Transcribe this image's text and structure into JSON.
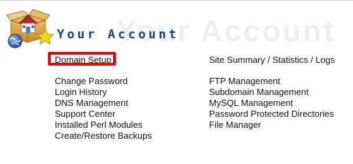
{
  "header": {
    "title": "Your Account",
    "ghost_title": "Your Account"
  },
  "links": {
    "domain_setup": "Domain Setup",
    "site_summary": "Site Summary / Statistics / Logs",
    "left_column": [
      "Change Password",
      "Login History",
      "DNS Management",
      "Support Center",
      "Installed Perl Modules",
      "Create/Restore Backups"
    ],
    "right_column": [
      "FTP Management",
      "Subdomain Management",
      "MySQL Management",
      "Password Protected Directories",
      "File Manager"
    ]
  },
  "icons": {
    "logo": "house-globe-star-icon"
  },
  "colors": {
    "title": "#1b3f86",
    "highlight": "#ee0000",
    "link": "#111111"
  }
}
